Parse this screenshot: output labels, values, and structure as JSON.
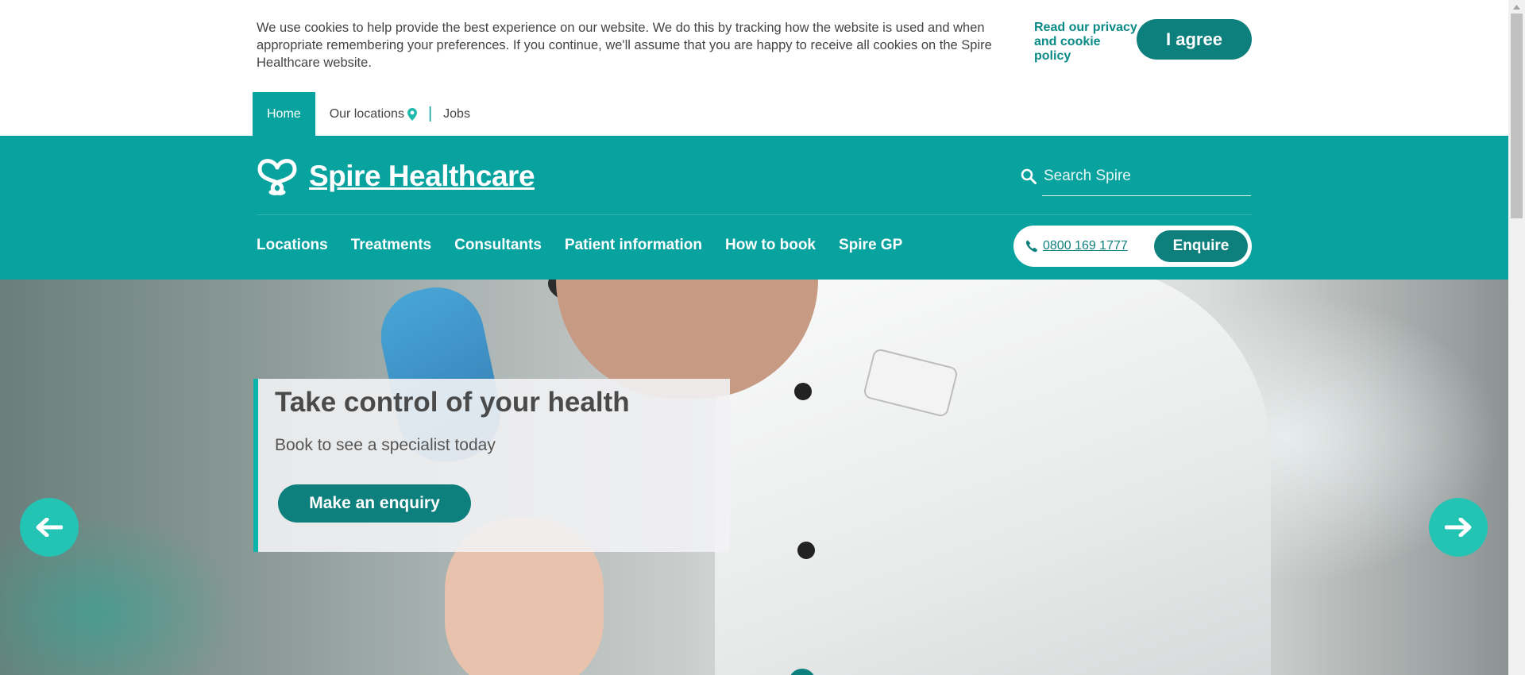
{
  "cookie": {
    "message": "We use cookies to help provide the best experience on our website. We do this by tracking how the website is used and when appropriate remembering your preferences. If you continue, we'll assume that you are happy to receive all cookies on the Spire Healthcare website.",
    "policy_link": "Read our privacy and cookie policy",
    "agree_label": "I agree"
  },
  "util_nav": {
    "home": "Home",
    "locations": "Our locations",
    "separator": "|",
    "jobs": "Jobs"
  },
  "brand": {
    "name": "Spire Healthcare",
    "accent": "#08a29f",
    "dark": "#0d7f7c",
    "arrow_color": "#24c4b4"
  },
  "search": {
    "placeholder": "Search Spire",
    "icon": "search-icon"
  },
  "main_nav": [
    {
      "label": "Locations"
    },
    {
      "label": "Treatments"
    },
    {
      "label": "Consultants"
    },
    {
      "label": "Patient information"
    },
    {
      "label": "How to book"
    },
    {
      "label": "Spire GP"
    }
  ],
  "contact": {
    "phone": "0800 169 1777",
    "enquire_label": "Enquire",
    "icon": "phone-icon"
  },
  "hero": {
    "title": "Take control of your health",
    "subtitle": "Book to see a specialist today",
    "cta_label": "Make an enquiry",
    "prev_icon": "arrow-left-icon",
    "next_icon": "arrow-right-icon"
  }
}
